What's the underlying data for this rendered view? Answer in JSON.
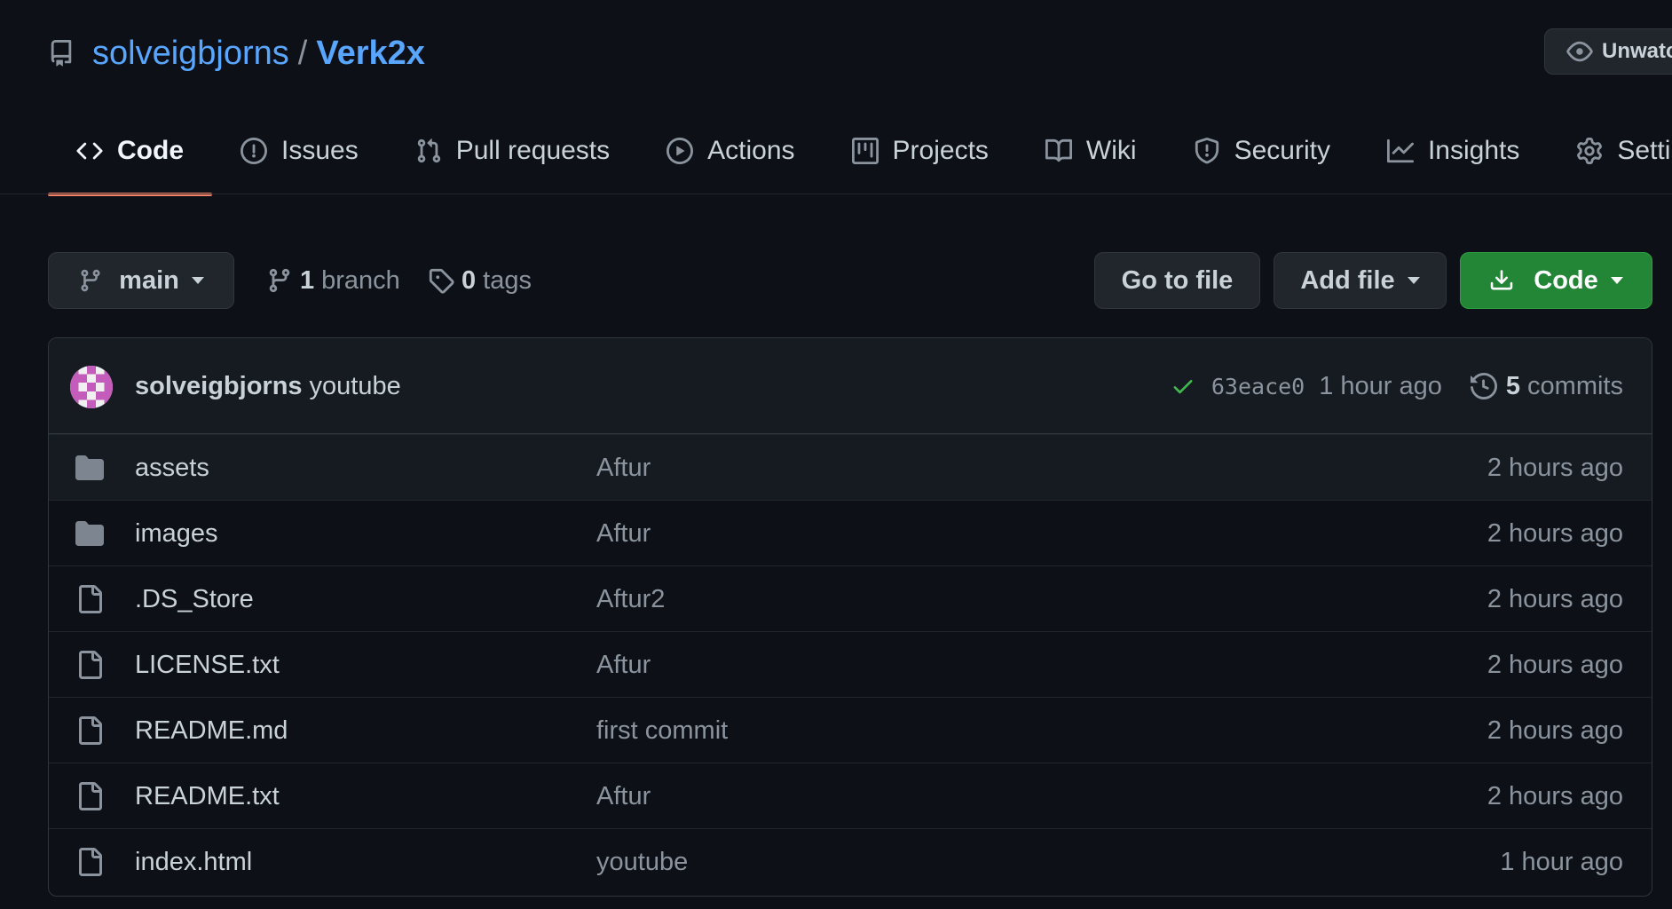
{
  "repo": {
    "owner": "solveigbjorns",
    "separator": "/",
    "name": "Verk2x",
    "watch_label": "Unwatch"
  },
  "tabs": [
    {
      "label": "Code",
      "icon": "code-icon",
      "active": true
    },
    {
      "label": "Issues",
      "icon": "issue-icon"
    },
    {
      "label": "Pull requests",
      "icon": "pull-request-icon"
    },
    {
      "label": "Actions",
      "icon": "play-icon"
    },
    {
      "label": "Projects",
      "icon": "project-icon"
    },
    {
      "label": "Wiki",
      "icon": "book-icon"
    },
    {
      "label": "Security",
      "icon": "shield-icon"
    },
    {
      "label": "Insights",
      "icon": "graph-icon"
    },
    {
      "label": "Settings",
      "icon": "gear-icon"
    }
  ],
  "branch_bar": {
    "current_branch": "main",
    "branch_count": "1",
    "branch_label": "branch",
    "tag_count": "0",
    "tag_label": "tags",
    "goto_label": "Go to file",
    "add_file_label": "Add file",
    "code_label": "Code"
  },
  "latest_commit": {
    "author": "solveigbjorns",
    "message": "youtube",
    "sha": "63eace0",
    "time": "1 hour ago",
    "commit_count": "5",
    "commit_label": "commits"
  },
  "files": [
    {
      "type": "dir",
      "name": "assets",
      "message": "Aftur",
      "time": "2 hours ago"
    },
    {
      "type": "dir",
      "name": "images",
      "message": "Aftur",
      "time": "2 hours ago"
    },
    {
      "type": "file",
      "name": ".DS_Store",
      "message": "Aftur2",
      "time": "2 hours ago"
    },
    {
      "type": "file",
      "name": "LICENSE.txt",
      "message": "Aftur",
      "time": "2 hours ago"
    },
    {
      "type": "file",
      "name": "README.md",
      "message": "first commit",
      "time": "2 hours ago"
    },
    {
      "type": "file",
      "name": "README.txt",
      "message": "Aftur",
      "time": "2 hours ago"
    },
    {
      "type": "file",
      "name": "index.html",
      "message": "youtube",
      "time": "1 hour ago"
    }
  ],
  "colors": {
    "background": "#0d1117",
    "link": "#58a6ff",
    "accent_underline": "#f78166",
    "primary_button": "#238636",
    "success": "#3fb950"
  }
}
